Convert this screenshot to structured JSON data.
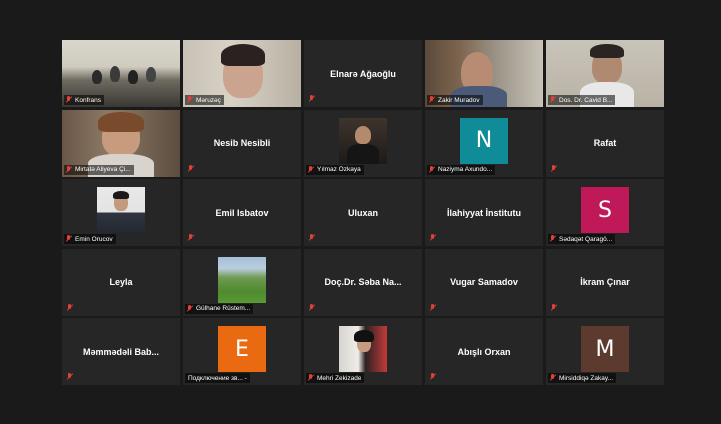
{
  "colors": {
    "background": "#1a1a1a",
    "tile": "#262626",
    "active_speaker_border": "#c8e35a",
    "muted_mic": "#e0413a"
  },
  "tiles": [
    {
      "name": "Konfrans",
      "kind": "video"
    },
    {
      "name": "Məruzəç",
      "kind": "video"
    },
    {
      "name": "Elnarə Ağaoğlu",
      "kind": "name"
    },
    {
      "name": "Zakir Muradov",
      "kind": "video"
    },
    {
      "name": "Dos. Dr. Cavid B...",
      "kind": "video"
    },
    {
      "name": "Mirtatə Aliyeva Çi...",
      "kind": "video"
    },
    {
      "name": "Nesib Nesibli",
      "kind": "name"
    },
    {
      "name": "Yılmaz Özkaya",
      "kind": "photo"
    },
    {
      "name": "Naziyma Axundo...",
      "kind": "letter",
      "letter": "N",
      "color": "#0f8c98"
    },
    {
      "name": "Rafat",
      "kind": "name"
    },
    {
      "name": "Emin Orucov",
      "kind": "photo"
    },
    {
      "name": "Emil Isbatov",
      "kind": "name"
    },
    {
      "name": "Uluxan",
      "kind": "name"
    },
    {
      "name": "İlahiyyat İnstitutu",
      "kind": "name"
    },
    {
      "name": "Sədaqət Qaragö...",
      "kind": "letter",
      "letter": "S",
      "color": "#c0195a"
    },
    {
      "name": "Leyla",
      "kind": "name"
    },
    {
      "name": "Gülhane Rüstem...",
      "kind": "photo"
    },
    {
      "name": "Doç.Dr. Səba Na...",
      "kind": "name"
    },
    {
      "name": "Vugar Samadov",
      "kind": "name"
    },
    {
      "name": "İkram Çınar",
      "kind": "name"
    },
    {
      "name": "Məmmədəli Bab...",
      "kind": "name"
    },
    {
      "name": "Подключение зв... -",
      "kind": "letter",
      "letter": "E",
      "color": "#ea6a12"
    },
    {
      "name": "Mehri Zekizade",
      "kind": "photo"
    },
    {
      "name": "Abışlı Orxan",
      "kind": "name"
    },
    {
      "name": "Mirsiddiqə Zakay...",
      "kind": "letter",
      "letter": "M",
      "color": "#5c3a2e"
    }
  ]
}
